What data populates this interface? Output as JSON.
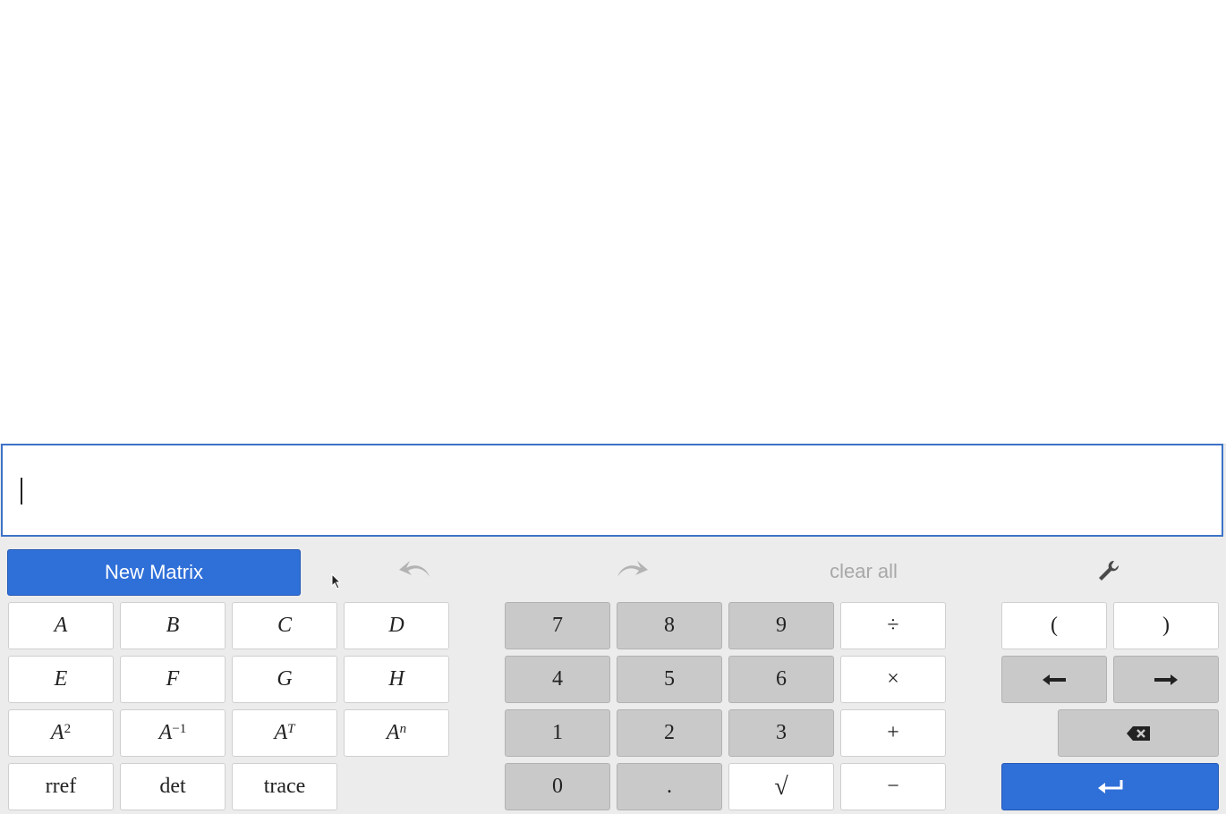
{
  "toolbar": {
    "new_matrix_label": "New Matrix",
    "clear_all_label": "clear all",
    "undo_icon": "undo-icon",
    "redo_icon": "redo-icon",
    "settings_icon": "wrench-icon"
  },
  "matrix_keys": {
    "a": "A",
    "b": "B",
    "c": "C",
    "d": "D",
    "e": "E",
    "f": "F",
    "g": "G",
    "h": "H",
    "sq_base": "A",
    "sq_exp": "2",
    "inv_base": "A",
    "inv_exp": "−1",
    "tr_base": "A",
    "tr_exp": "T",
    "pow_base": "A",
    "pow_exp": "n",
    "rref": "rref",
    "det": "det",
    "trace": "trace"
  },
  "numpad": {
    "n7": "7",
    "n8": "8",
    "n9": "9",
    "div": "÷",
    "n4": "4",
    "n5": "5",
    "n6": "6",
    "mul": "×",
    "n1": "1",
    "n2": "2",
    "n3": "3",
    "add": "+",
    "n0": "0",
    "dot": ".",
    "sqrt": "√",
    "sub": "−"
  },
  "nav": {
    "lparen": "(",
    "rparen": ")"
  },
  "colors": {
    "accent": "#2f6fd8",
    "key_gray": "#c9c9c9",
    "key_white": "#ffffff",
    "background": "#ececec"
  }
}
